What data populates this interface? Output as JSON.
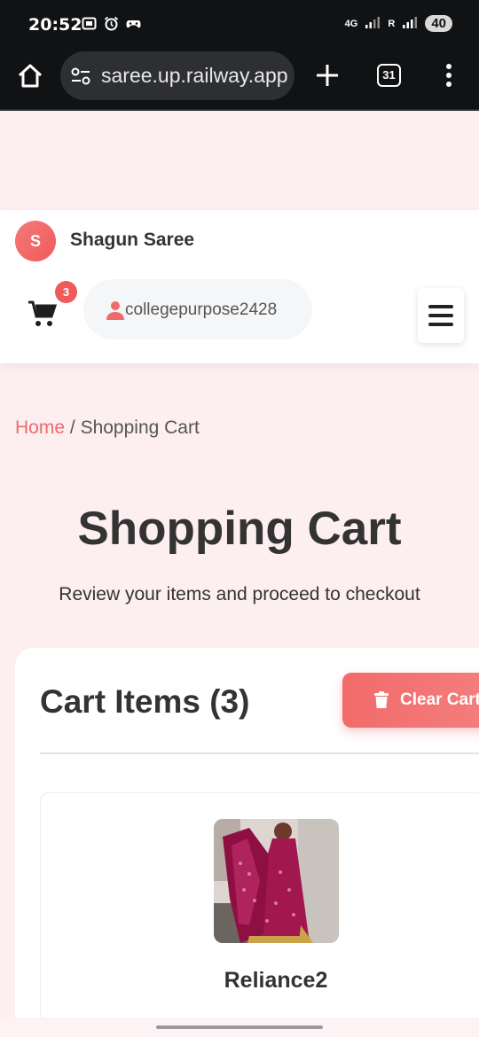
{
  "status_bar": {
    "time": "20:52",
    "network": "4G",
    "roaming": "R",
    "battery": "40",
    "icons": [
      "screenshot-icon",
      "alarm-icon",
      "gamepad-icon"
    ]
  },
  "browser": {
    "url": "saree.up.railway.app",
    "tab_count": "31",
    "icons": [
      "home-icon",
      "site-settings-icon",
      "new-tab-icon",
      "tabs-icon",
      "more-icon"
    ]
  },
  "header": {
    "logo_letter": "S",
    "brand": "Shagun Saree",
    "cart_count": "3",
    "username": "collegepurpose2428"
  },
  "breadcrumb": {
    "home": "Home",
    "separator": "/",
    "current": "Shopping Cart"
  },
  "page": {
    "title": "Shopping Cart",
    "subtitle": "Review your items and proceed to checkout"
  },
  "cart": {
    "items_title": "Cart Items (3)",
    "clear_label": "Clear Cart",
    "items": [
      {
        "name": "Reliance2"
      }
    ]
  },
  "colors": {
    "accent": "#ef5a5a",
    "page_background": "#fdeef0",
    "browser_chrome": "#101214"
  }
}
